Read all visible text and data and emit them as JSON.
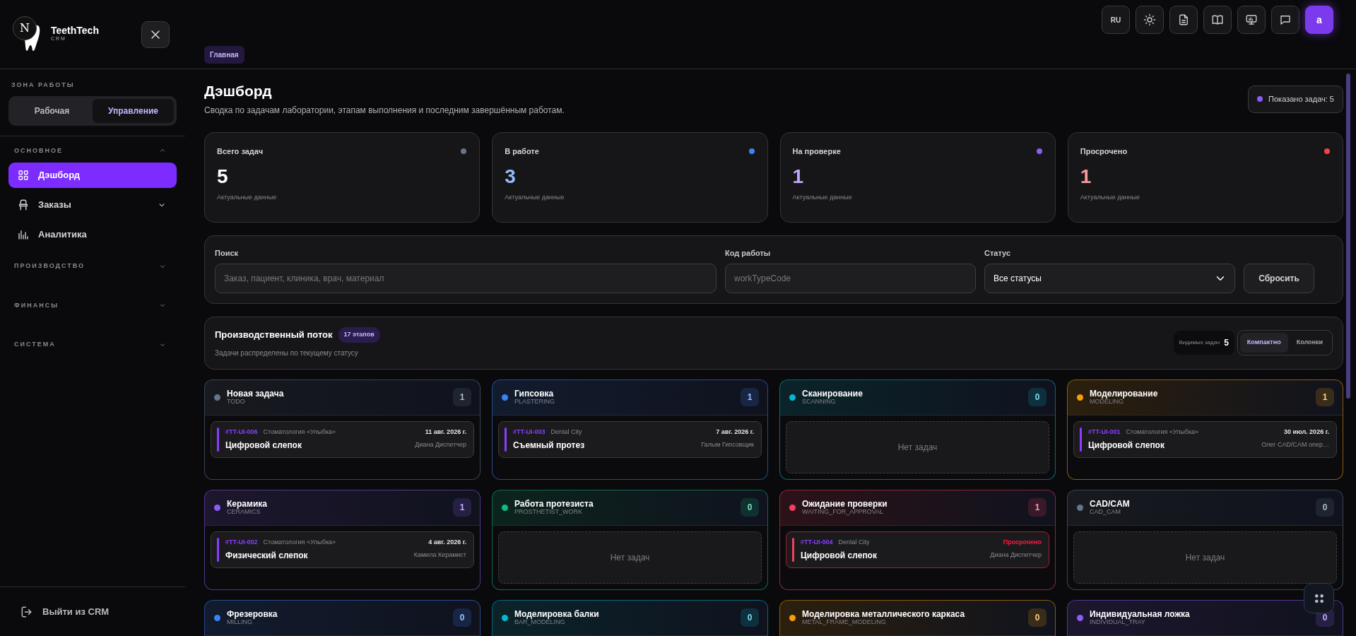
{
  "brand": {
    "mark": "N",
    "name": "TeethTech",
    "sub": "CRM"
  },
  "sidebar": {
    "zone_label": "ЗОНА РАБОТЫ",
    "zones": [
      {
        "label": "Рабочая",
        "selected": false
      },
      {
        "label": "Управление",
        "selected": true
      }
    ],
    "groups": [
      {
        "label": "ОСНОВНОЕ",
        "expanded": true,
        "items": [
          {
            "label": "Дэшборд",
            "selected": true,
            "has_submenu": false
          },
          {
            "label": "Заказы",
            "selected": false,
            "has_submenu": true
          },
          {
            "label": "Аналитика",
            "selected": false,
            "has_submenu": false
          }
        ]
      },
      {
        "label": "ПРОИЗВОДСТВО",
        "expanded": false
      },
      {
        "label": "ФИНАНСЫ",
        "expanded": false
      },
      {
        "label": "СИСТЕМА",
        "expanded": false
      }
    ],
    "logout": "Выйти из CRM"
  },
  "toolbar": {
    "language": "RU",
    "avatar": "a"
  },
  "breadcrumb": "Главная",
  "page": {
    "title": "Дэшборд",
    "subtitle": "Сводка по задачам лаборатории, этапам выполнения и последним завершённым работам.",
    "shown": "Показано задач: 5"
  },
  "stats": [
    {
      "label": "Всего задач",
      "value": "5",
      "caption": "Актуальные данные",
      "color": "#64748b"
    },
    {
      "label": "В работе",
      "value": "3",
      "caption": "Актуальные данные",
      "color": "#3b82f6"
    },
    {
      "label": "На проверке",
      "value": "1",
      "caption": "Актуальные данные",
      "color": "#8b5cf6"
    },
    {
      "label": "Просрочено",
      "value": "1",
      "caption": "Актуальные данные",
      "color": "#ef4444"
    }
  ],
  "filters": {
    "search": {
      "label": "Поиск",
      "placeholder": "Заказ, пациент, клиника, врач, материал"
    },
    "code": {
      "label": "Код работы",
      "placeholder": "workTypeCode"
    },
    "status": {
      "label": "Статус",
      "value": "Все статусы"
    },
    "reset": "Сбросить"
  },
  "flow": {
    "title": "Производственный поток",
    "badge": "17 этапов",
    "subtitle": "Задачи распределены по текущему статусу",
    "visible_label": "Видимых задач",
    "visible_count": "5",
    "views": [
      {
        "label": "Компактно",
        "selected": true
      },
      {
        "label": "Колонки",
        "selected": false
      }
    ],
    "stages": [
      {
        "title": "Новая задача",
        "code": "TODO",
        "count": "1",
        "color": "#64748b",
        "tasks": [
          {
            "id": "#TT-UI-006",
            "clinic": "Стоматология «Улыбка»",
            "due": "11 авг. 2026 г.",
            "title": "Цифровой слепок",
            "assignee": "Диана Диспетчер",
            "overdue": false
          }
        ]
      },
      {
        "title": "Гипсовка",
        "code": "PLASTERING",
        "count": "1",
        "color": "#3b82f6",
        "tasks": [
          {
            "id": "#TT-UI-003",
            "clinic": "Dental City",
            "due": "7 авг. 2026 г.",
            "title": "Съемный протез",
            "assignee": "Галым Гипсовщик",
            "overdue": false
          }
        ]
      },
      {
        "title": "Сканирование",
        "code": "SCANNING",
        "count": "0",
        "color": "#06b6d4",
        "empty_text": "Нет задач"
      },
      {
        "title": "Моделирование",
        "code": "MODELING",
        "count": "1",
        "color": "#f59e0b",
        "tasks": [
          {
            "id": "#TT-UI-001",
            "clinic": "Стоматология «Улыбка»",
            "due": "30 июл. 2026 г.",
            "title": "Цифровой слепок",
            "assignee": "Олег CAD/CAM опер…",
            "overdue": false
          }
        ]
      },
      {
        "title": "Керамика",
        "code": "CERAMICS",
        "count": "1",
        "color": "#8b5cf6",
        "tasks": [
          {
            "id": "#TT-UI-002",
            "clinic": "Стоматология «Улыбка»",
            "due": "4 авг. 2026 г.",
            "title": "Физический слепок",
            "assignee": "Камила Керамист",
            "overdue": false
          }
        ]
      },
      {
        "title": "Работа протезиста",
        "code": "PROSTHETIST_WORK",
        "count": "0",
        "color": "#10b981",
        "empty_text": "Нет задач"
      },
      {
        "title": "Ожидание проверки",
        "code": "WAITING_FOR_APPROVAL",
        "count": "1",
        "color": "#f43f5e",
        "tasks": [
          {
            "id": "#TT-UI-004",
            "clinic": "Dental City",
            "due": "Просрочено",
            "title": "Цифровой слепок",
            "assignee": "Диана Диспетчер",
            "overdue": true
          }
        ]
      },
      {
        "title": "CAD/CAM",
        "code": "CAD_CAM",
        "count": "0",
        "color": "#64748b",
        "empty_text": "Нет задач"
      },
      {
        "title": "Фрезеровка",
        "code": "MILLING",
        "count": "0",
        "color": "#3b82f6"
      },
      {
        "title": "Моделировка балки",
        "code": "BAR_MODELING",
        "count": "0",
        "color": "#06b6d4"
      },
      {
        "title": "Моделировка металлического каркаса",
        "code": "METAL_FRAME_MODELING",
        "count": "0",
        "color": "#f59e0b"
      },
      {
        "title": "Индивидуальная ложка",
        "code": "INDIVIDUAL_TRAY",
        "count": "0",
        "color": "#8b5cf6"
      }
    ]
  }
}
